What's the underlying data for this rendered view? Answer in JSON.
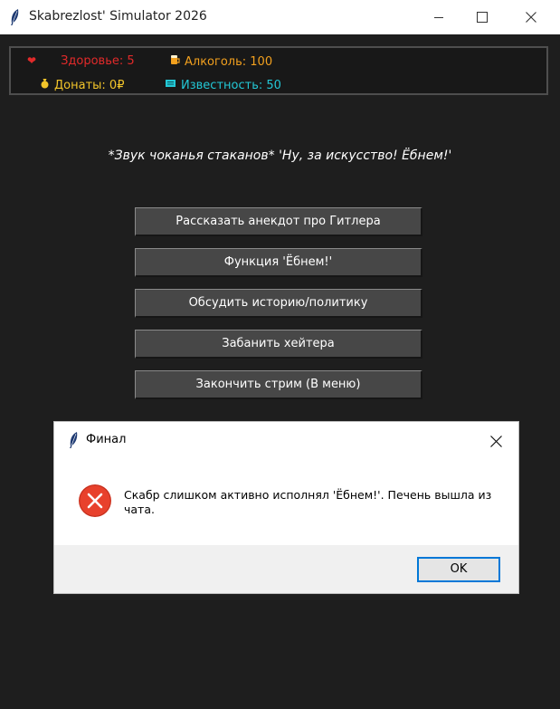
{
  "window": {
    "title": "Skabrezlost' Simulator 2026",
    "icon": "feather-icon"
  },
  "stats": {
    "health": {
      "label": "Здоровье: 5",
      "icon": "heart-icon",
      "color": "#e22a2a"
    },
    "alcohol": {
      "label": "Алкоголь: 100",
      "icon": "beer-icon",
      "color": "#f2a01e"
    },
    "donations": {
      "label": "Донаты: 0₽",
      "icon": "money-bag-icon",
      "color": "#f3c52a"
    },
    "fame": {
      "label": "Известность: 50",
      "icon": "scroll-icon",
      "color": "#23c8d6"
    }
  },
  "message": "*Звук чоканья стаканов* 'Ну, за искусство! Ёбнем!'",
  "menu": [
    {
      "label": "Рассказать анекдот про Гитлера"
    },
    {
      "label": "Функция 'Ёбнем!'"
    },
    {
      "label": "Обсудить историю/политику"
    },
    {
      "label": "Забанить хейтера"
    },
    {
      "label": "Закончить стрим (В меню)"
    }
  ],
  "dialog": {
    "title": "Финал",
    "icon": "error-icon",
    "message": "Скабр слишком активно исполнял 'Ёбнем!'. Печень вышла из чата.",
    "ok_label": "OK"
  }
}
